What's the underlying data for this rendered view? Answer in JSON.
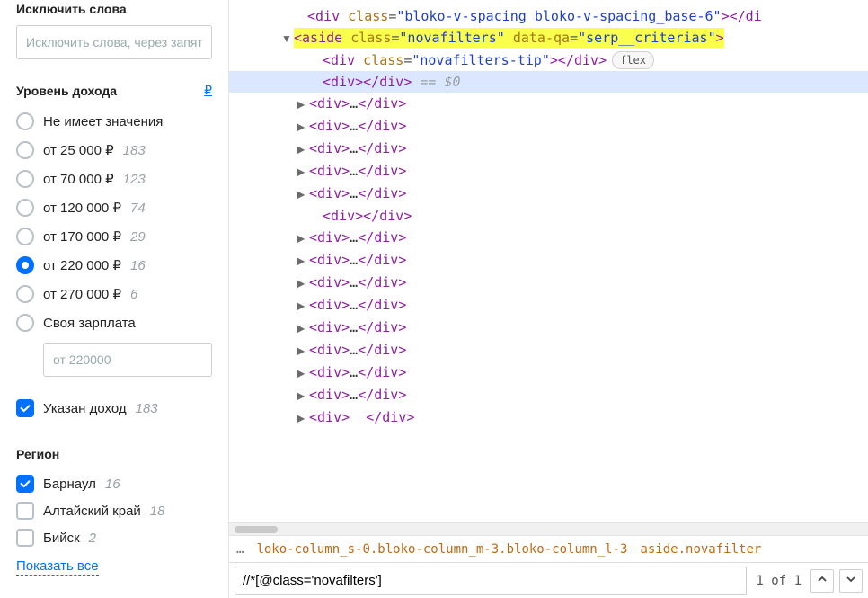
{
  "sidebar": {
    "exclude": {
      "title": "Исключить слова",
      "placeholder": "Исключить слова, через запятую"
    },
    "income": {
      "title": "Уровень дохода",
      "currency_button": "₽",
      "options": [
        {
          "label": "Не имеет значения",
          "count": "",
          "checked": false
        },
        {
          "label": "от 25 000 ₽",
          "count": "183",
          "checked": false
        },
        {
          "label": "от 70 000 ₽",
          "count": "123",
          "checked": false
        },
        {
          "label": "от 120 000 ₽",
          "count": "74",
          "checked": false
        },
        {
          "label": "от 170 000 ₽",
          "count": "29",
          "checked": false
        },
        {
          "label": "от 220 000 ₽",
          "count": "16",
          "checked": true
        },
        {
          "label": "от 270 000 ₽",
          "count": "6",
          "checked": false
        },
        {
          "label": "Своя зарплата",
          "count": "",
          "checked": false
        }
      ],
      "custom_placeholder": "от 220000",
      "show_with_salary": {
        "label": "Указан доход",
        "count": "183",
        "checked": true
      }
    },
    "region": {
      "title": "Регион",
      "items": [
        {
          "label": "Барнаул",
          "count": "16",
          "checked": true
        },
        {
          "label": "Алтайский край",
          "count": "18",
          "checked": false
        },
        {
          "label": "Бийск",
          "count": "2",
          "checked": false
        }
      ],
      "show_all": "Показать все"
    }
  },
  "dom": {
    "lines": [
      {
        "indent": 87,
        "arrow": "",
        "sel": false,
        "hl": false,
        "parts": [
          {
            "c": "t-bracket",
            "t": "<"
          },
          {
            "c": "t-tag",
            "t": "div"
          },
          {
            "c": "",
            "t": " "
          },
          {
            "c": "t-attr",
            "t": "class"
          },
          {
            "c": "t-eq",
            "t": "="
          },
          {
            "c": "t-val",
            "t": "\"bloko-v-spacing bloko-v-spacing_base-6\""
          },
          {
            "c": "t-bracket",
            "t": "></"
          },
          {
            "c": "t-tag",
            "t": "di"
          }
        ]
      },
      {
        "indent": 72,
        "arrow": "▼",
        "sel": false,
        "hl": true,
        "parts": [
          {
            "c": "t-bracket",
            "t": "<"
          },
          {
            "c": "t-tag",
            "t": "aside"
          },
          {
            "c": "",
            "t": " "
          },
          {
            "c": "t-attr",
            "t": "class"
          },
          {
            "c": "t-eq",
            "t": "="
          },
          {
            "c": "t-val",
            "t": "\"novafilters\""
          },
          {
            "c": "",
            "t": " "
          },
          {
            "c": "t-attr",
            "t": "data-qa"
          },
          {
            "c": "t-eq",
            "t": "="
          },
          {
            "c": "t-val",
            "t": "\"serp__criterias\""
          },
          {
            "c": "t-bracket",
            "t": ">"
          }
        ]
      },
      {
        "indent": 104,
        "arrow": "",
        "sel": false,
        "hl": false,
        "pill": "flex",
        "parts": [
          {
            "c": "t-bracket",
            "t": "<"
          },
          {
            "c": "t-tag",
            "t": "div"
          },
          {
            "c": "",
            "t": " "
          },
          {
            "c": "t-attr",
            "t": "class"
          },
          {
            "c": "t-eq",
            "t": "="
          },
          {
            "c": "t-val",
            "t": "\"novafilters-tip\""
          },
          {
            "c": "t-bracket",
            "t": "></"
          },
          {
            "c": "t-tag",
            "t": "div"
          },
          {
            "c": "t-bracket",
            "t": ">"
          }
        ]
      },
      {
        "indent": 104,
        "arrow": "",
        "sel": true,
        "hl": false,
        "parts": [
          {
            "c": "t-bracket",
            "t": "<"
          },
          {
            "c": "t-tag",
            "t": "div"
          },
          {
            "c": "t-bracket",
            "t": "></"
          },
          {
            "c": "t-tag",
            "t": "div"
          },
          {
            "c": "t-bracket",
            "t": ">"
          },
          {
            "c": "t-comment",
            "t": " == $0"
          }
        ]
      },
      {
        "indent": 89,
        "arrow": "▶",
        "sel": false,
        "hl": false,
        "parts": [
          {
            "c": "t-bracket",
            "t": "<"
          },
          {
            "c": "t-tag",
            "t": "div"
          },
          {
            "c": "t-bracket",
            "t": ">"
          },
          {
            "c": "t-ell",
            "t": "…"
          },
          {
            "c": "t-bracket",
            "t": "</"
          },
          {
            "c": "t-tag",
            "t": "div"
          },
          {
            "c": "t-bracket",
            "t": ">"
          }
        ]
      },
      {
        "indent": 89,
        "arrow": "▶",
        "sel": false,
        "hl": false,
        "parts": [
          {
            "c": "t-bracket",
            "t": "<"
          },
          {
            "c": "t-tag",
            "t": "div"
          },
          {
            "c": "t-bracket",
            "t": ">"
          },
          {
            "c": "t-ell",
            "t": "…"
          },
          {
            "c": "t-bracket",
            "t": "</"
          },
          {
            "c": "t-tag",
            "t": "div"
          },
          {
            "c": "t-bracket",
            "t": ">"
          }
        ]
      },
      {
        "indent": 89,
        "arrow": "▶",
        "sel": false,
        "hl": false,
        "parts": [
          {
            "c": "t-bracket",
            "t": "<"
          },
          {
            "c": "t-tag",
            "t": "div"
          },
          {
            "c": "t-bracket",
            "t": ">"
          },
          {
            "c": "t-ell",
            "t": "…"
          },
          {
            "c": "t-bracket",
            "t": "</"
          },
          {
            "c": "t-tag",
            "t": "div"
          },
          {
            "c": "t-bracket",
            "t": ">"
          }
        ]
      },
      {
        "indent": 89,
        "arrow": "▶",
        "sel": false,
        "hl": false,
        "parts": [
          {
            "c": "t-bracket",
            "t": "<"
          },
          {
            "c": "t-tag",
            "t": "div"
          },
          {
            "c": "t-bracket",
            "t": ">"
          },
          {
            "c": "t-ell",
            "t": "…"
          },
          {
            "c": "t-bracket",
            "t": "</"
          },
          {
            "c": "t-tag",
            "t": "div"
          },
          {
            "c": "t-bracket",
            "t": ">"
          }
        ]
      },
      {
        "indent": 89,
        "arrow": "▶",
        "sel": false,
        "hl": false,
        "parts": [
          {
            "c": "t-bracket",
            "t": "<"
          },
          {
            "c": "t-tag",
            "t": "div"
          },
          {
            "c": "t-bracket",
            "t": ">"
          },
          {
            "c": "t-ell",
            "t": "…"
          },
          {
            "c": "t-bracket",
            "t": "</"
          },
          {
            "c": "t-tag",
            "t": "div"
          },
          {
            "c": "t-bracket",
            "t": ">"
          }
        ]
      },
      {
        "indent": 104,
        "arrow": "",
        "sel": false,
        "hl": false,
        "parts": [
          {
            "c": "t-bracket",
            "t": "<"
          },
          {
            "c": "t-tag",
            "t": "div"
          },
          {
            "c": "t-bracket",
            "t": "></"
          },
          {
            "c": "t-tag",
            "t": "div"
          },
          {
            "c": "t-bracket",
            "t": ">"
          }
        ]
      },
      {
        "indent": 89,
        "arrow": "▶",
        "sel": false,
        "hl": false,
        "parts": [
          {
            "c": "t-bracket",
            "t": "<"
          },
          {
            "c": "t-tag",
            "t": "div"
          },
          {
            "c": "t-bracket",
            "t": ">"
          },
          {
            "c": "t-ell",
            "t": "…"
          },
          {
            "c": "t-bracket",
            "t": "</"
          },
          {
            "c": "t-tag",
            "t": "div"
          },
          {
            "c": "t-bracket",
            "t": ">"
          }
        ]
      },
      {
        "indent": 89,
        "arrow": "▶",
        "sel": false,
        "hl": false,
        "parts": [
          {
            "c": "t-bracket",
            "t": "<"
          },
          {
            "c": "t-tag",
            "t": "div"
          },
          {
            "c": "t-bracket",
            "t": ">"
          },
          {
            "c": "t-ell",
            "t": "…"
          },
          {
            "c": "t-bracket",
            "t": "</"
          },
          {
            "c": "t-tag",
            "t": "div"
          },
          {
            "c": "t-bracket",
            "t": ">"
          }
        ]
      },
      {
        "indent": 89,
        "arrow": "▶",
        "sel": false,
        "hl": false,
        "parts": [
          {
            "c": "t-bracket",
            "t": "<"
          },
          {
            "c": "t-tag",
            "t": "div"
          },
          {
            "c": "t-bracket",
            "t": ">"
          },
          {
            "c": "t-ell",
            "t": "…"
          },
          {
            "c": "t-bracket",
            "t": "</"
          },
          {
            "c": "t-tag",
            "t": "div"
          },
          {
            "c": "t-bracket",
            "t": ">"
          }
        ]
      },
      {
        "indent": 89,
        "arrow": "▶",
        "sel": false,
        "hl": false,
        "parts": [
          {
            "c": "t-bracket",
            "t": "<"
          },
          {
            "c": "t-tag",
            "t": "div"
          },
          {
            "c": "t-bracket",
            "t": ">"
          },
          {
            "c": "t-ell",
            "t": "…"
          },
          {
            "c": "t-bracket",
            "t": "</"
          },
          {
            "c": "t-tag",
            "t": "div"
          },
          {
            "c": "t-bracket",
            "t": ">"
          }
        ]
      },
      {
        "indent": 89,
        "arrow": "▶",
        "sel": false,
        "hl": false,
        "parts": [
          {
            "c": "t-bracket",
            "t": "<"
          },
          {
            "c": "t-tag",
            "t": "div"
          },
          {
            "c": "t-bracket",
            "t": ">"
          },
          {
            "c": "t-ell",
            "t": "…"
          },
          {
            "c": "t-bracket",
            "t": "</"
          },
          {
            "c": "t-tag",
            "t": "div"
          },
          {
            "c": "t-bracket",
            "t": ">"
          }
        ]
      },
      {
        "indent": 89,
        "arrow": "▶",
        "sel": false,
        "hl": false,
        "parts": [
          {
            "c": "t-bracket",
            "t": "<"
          },
          {
            "c": "t-tag",
            "t": "div"
          },
          {
            "c": "t-bracket",
            "t": ">"
          },
          {
            "c": "t-ell",
            "t": "…"
          },
          {
            "c": "t-bracket",
            "t": "</"
          },
          {
            "c": "t-tag",
            "t": "div"
          },
          {
            "c": "t-bracket",
            "t": ">"
          }
        ]
      },
      {
        "indent": 89,
        "arrow": "▶",
        "sel": false,
        "hl": false,
        "parts": [
          {
            "c": "t-bracket",
            "t": "<"
          },
          {
            "c": "t-tag",
            "t": "div"
          },
          {
            "c": "t-bracket",
            "t": ">"
          },
          {
            "c": "t-ell",
            "t": "…"
          },
          {
            "c": "t-bracket",
            "t": "</"
          },
          {
            "c": "t-tag",
            "t": "div"
          },
          {
            "c": "t-bracket",
            "t": ">"
          }
        ]
      },
      {
        "indent": 89,
        "arrow": "▶",
        "sel": false,
        "hl": false,
        "parts": [
          {
            "c": "t-bracket",
            "t": "<"
          },
          {
            "c": "t-tag",
            "t": "div"
          },
          {
            "c": "t-bracket",
            "t": ">"
          },
          {
            "c": "t-ell",
            "t": "…"
          },
          {
            "c": "t-bracket",
            "t": "</"
          },
          {
            "c": "t-tag",
            "t": "div"
          },
          {
            "c": "t-bracket",
            "t": ">"
          }
        ]
      },
      {
        "indent": 89,
        "arrow": "▶",
        "sel": false,
        "hl": false,
        "parts": [
          {
            "c": "t-bracket",
            "t": "<"
          },
          {
            "c": "t-tag",
            "t": "div"
          },
          {
            "c": "t-bracket",
            "t": ">"
          },
          {
            "c": "t-ell",
            "t": "  "
          },
          {
            "c": "t-bracket",
            "t": "</"
          },
          {
            "c": "t-tag",
            "t": "div"
          },
          {
            "c": "t-bracket",
            "t": ">"
          }
        ]
      }
    ]
  },
  "breadcrumb": {
    "dots": "…",
    "crumbs": [
      "loko-column_s-0.bloko-column_m-3.bloko-column_l-3",
      "aside.novafilter"
    ]
  },
  "search": {
    "value": "//*[@class='novafilters']",
    "count": "1 of 1"
  },
  "icons": {
    "check": "✓"
  }
}
